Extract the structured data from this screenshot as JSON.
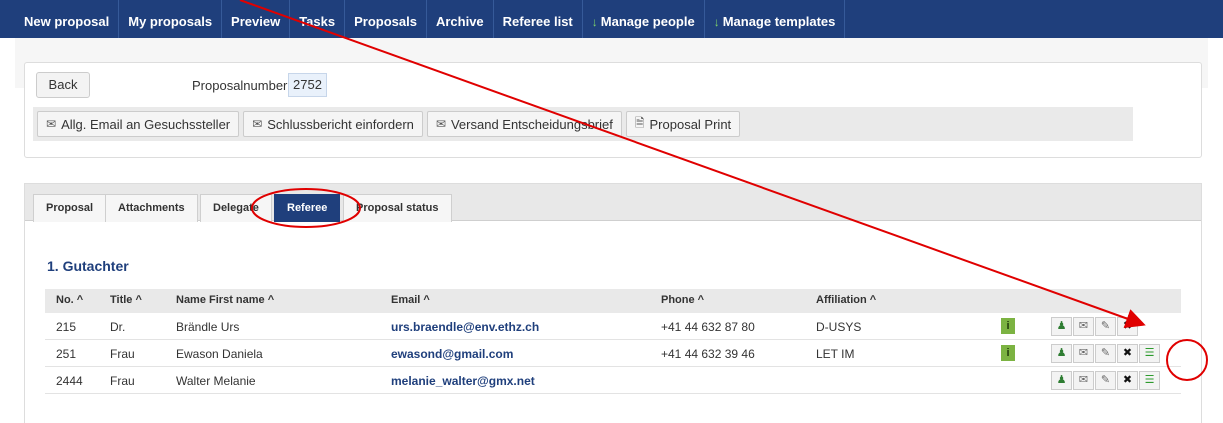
{
  "nav": {
    "items": [
      {
        "label": "New proposal",
        "arrow": ""
      },
      {
        "label": "My proposals",
        "arrow": ""
      },
      {
        "label": "Preview",
        "arrow": ""
      },
      {
        "label": "Tasks",
        "arrow": ""
      },
      {
        "label": "Proposals",
        "arrow": ""
      },
      {
        "label": "Archive",
        "arrow": ""
      },
      {
        "label": "Referee list",
        "arrow": ""
      },
      {
        "label": "Manage people",
        "arrow": "↓"
      },
      {
        "label": "Manage templates",
        "arrow": "↓"
      }
    ]
  },
  "proposal": {
    "back_label": "Back",
    "number_label": "Proposalnumber:",
    "number_value": "2752",
    "actions": [
      {
        "label": "Allg. Email an Gesuchssteller",
        "icon": "envelope-icon",
        "glyph": "✉"
      },
      {
        "label": "Schlussbericht einfordern",
        "icon": "envelope-icon",
        "glyph": "✉"
      },
      {
        "label": "Versand Entscheidungsbrief",
        "icon": "envelope-icon",
        "glyph": "✉"
      },
      {
        "label": "Proposal Print",
        "icon": "pdf-icon",
        "glyph": "🗎"
      }
    ]
  },
  "tabs": [
    {
      "label": "Proposal"
    },
    {
      "label": "Attachments"
    },
    {
      "label": "Delegate"
    },
    {
      "label": "Referee"
    },
    {
      "label": "Proposal status"
    }
  ],
  "section": {
    "title": "1. Gutachter"
  },
  "table": {
    "headers": [
      "No. ^",
      "Title ^",
      "Name First name ^",
      "Email ^",
      "Phone ^",
      "Affiliation ^"
    ],
    "rows": [
      {
        "no": "215",
        "title": "Dr.",
        "name": "Brändle Urs",
        "email": "urs.braendle@env.ethz.ch",
        "phone": "+41 44 632 87 80",
        "affiliation": "D-USYS"
      },
      {
        "no": "251",
        "title": "Frau",
        "name": "Ewason Daniela",
        "email": "ewasond@gmail.com",
        "phone": "+41 44 632 39 46",
        "affiliation": "LET IM"
      },
      {
        "no": "2444",
        "title": "Frau",
        "name": "Walter Melanie",
        "email": "melanie_walter@gmx.net",
        "phone": "",
        "affiliation": ""
      }
    ],
    "info_glyph": "i",
    "action_glyphs": {
      "user": "♟",
      "mail": "✉",
      "edit": "✎",
      "delete": "✖",
      "list": "☰"
    }
  },
  "colors": {
    "nav_bg": "#1f3f7c",
    "active_tab": "#1f3f7c",
    "annotation": "#e00000",
    "info_badge": "#7cb342"
  }
}
